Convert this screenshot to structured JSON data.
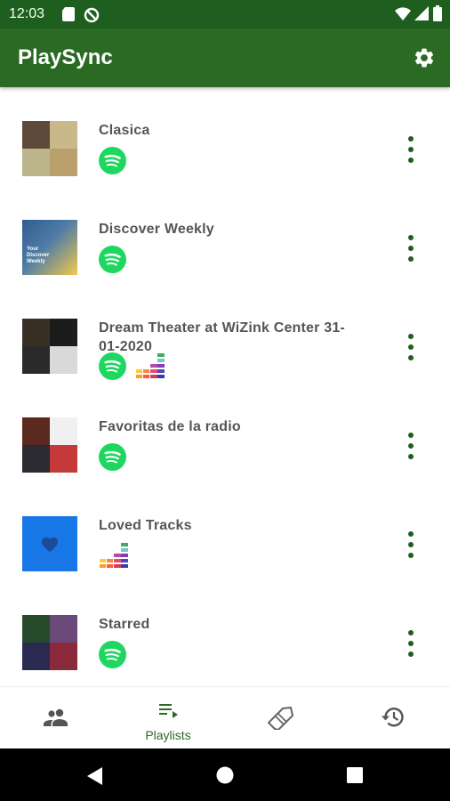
{
  "status_bar": {
    "time": "12:03",
    "icons": [
      "sd-card-icon",
      "data-saver-icon",
      "wifi-icon",
      "signal-icon",
      "battery-icon"
    ]
  },
  "app_bar": {
    "title": "PlaySync",
    "settings_icon": "gear-icon"
  },
  "playlists": [
    {
      "name": "Clasica",
      "sources": [
        "spotify"
      ],
      "art_colors": [
        "#5d4a3a",
        "#c9b98a",
        "#bdb58c",
        "#b9a06c"
      ]
    },
    {
      "name": "Discover Weekly",
      "sources": [
        "spotify"
      ],
      "art_text": "Your Discover Weekly",
      "art_colors": [
        "#2f5c8f",
        "#f2c94c"
      ]
    },
    {
      "name": "Dream Theater at WiZink Center 31-01-2020",
      "sources": [
        "spotify",
        "deezer"
      ],
      "art_colors": [
        "#3a2f25",
        "#1c1c1c",
        "#2a2a2a",
        "#d9d9d9"
      ]
    },
    {
      "name": "Favoritas de la radio",
      "sources": [
        "spotify"
      ],
      "art_colors": [
        "#5a2a20",
        "#f0f0f0",
        "#2a2a30",
        "#c43a3a"
      ]
    },
    {
      "name": "Loved Tracks",
      "sources": [
        "deezer"
      ],
      "art_colors": [
        "#1877e6"
      ]
    },
    {
      "name": "Starred",
      "sources": [
        "spotify"
      ],
      "art_colors": [
        "#274a2a",
        "#6b4a7a",
        "#2a2a50",
        "#8a2a3a"
      ]
    }
  ],
  "bottom_nav": {
    "tabs": [
      {
        "icon": "people-icon",
        "label": "",
        "active": false
      },
      {
        "icon": "playlist-icon",
        "label": "Playlists",
        "active": true
      },
      {
        "icon": "tag-icon",
        "label": "",
        "active": false
      },
      {
        "icon": "history-icon",
        "label": "",
        "active": false
      }
    ]
  },
  "system_nav": {
    "icons": [
      "back-icon",
      "home-icon",
      "recents-icon"
    ]
  },
  "colors": {
    "primary_dark": "#1e5e1e",
    "primary": "#2a6a22",
    "spotify_green": "#1ed760",
    "text_grey": "#555555"
  }
}
